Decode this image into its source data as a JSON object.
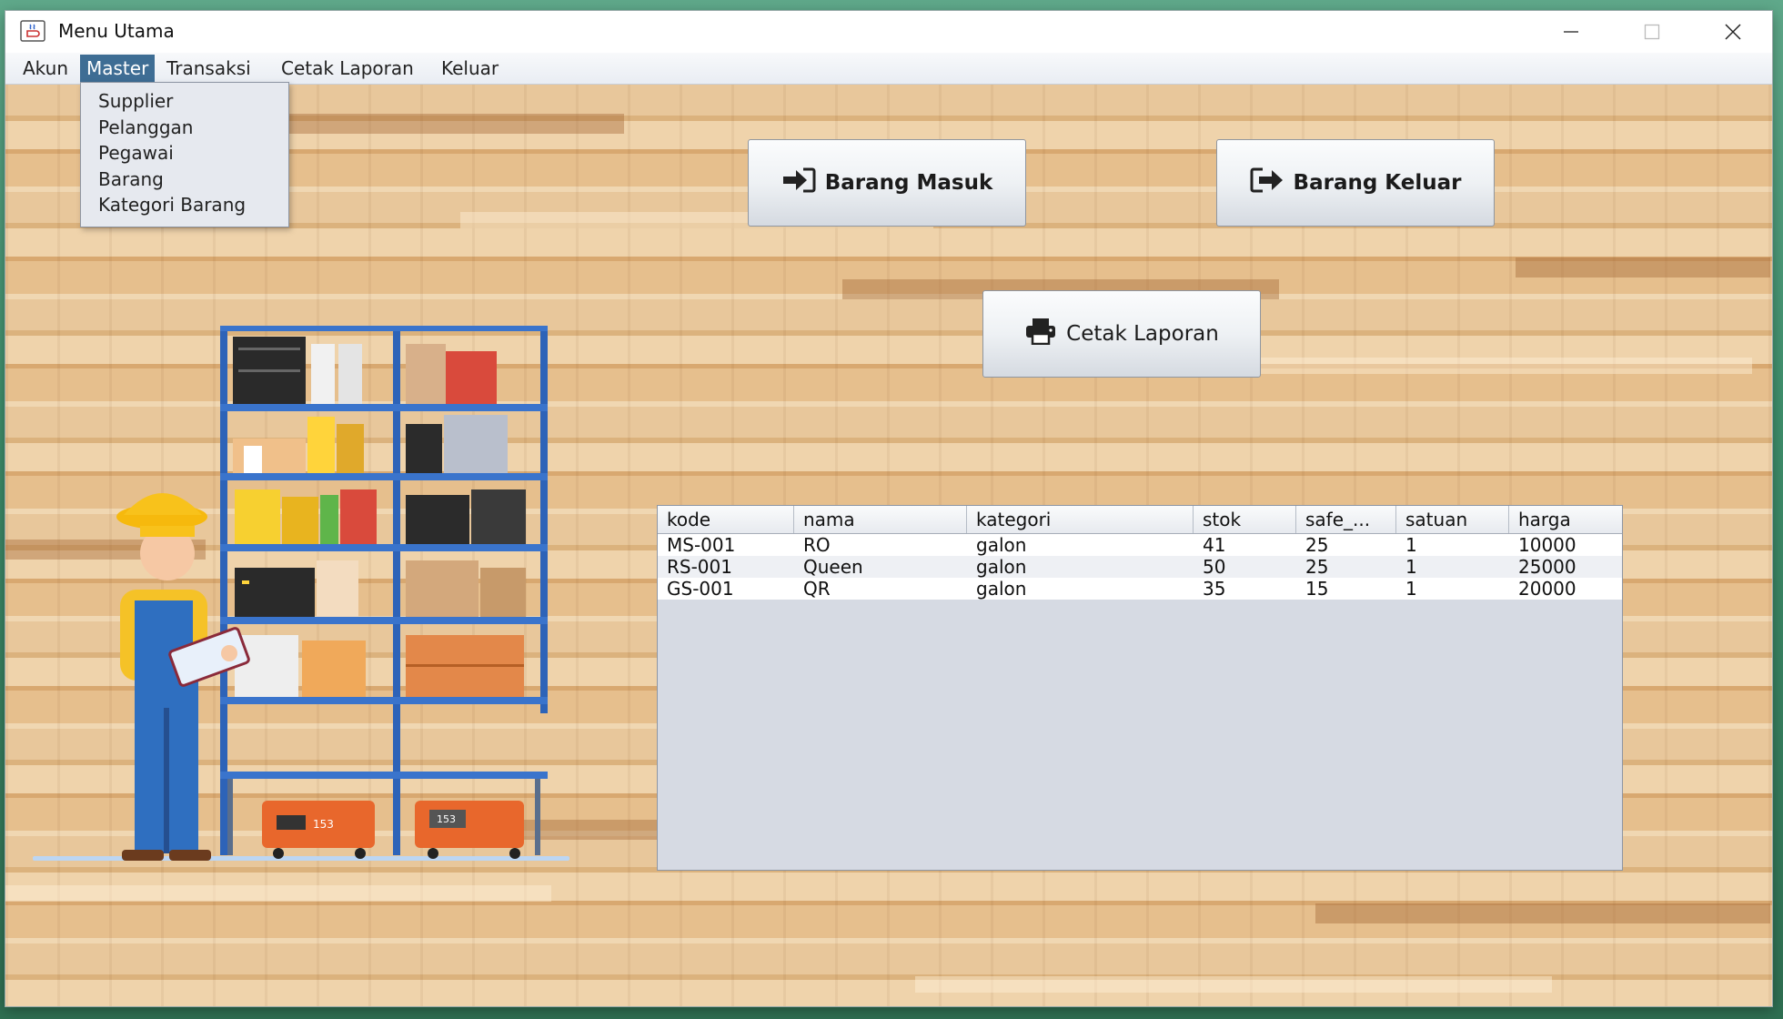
{
  "window": {
    "title": "Menu Utama"
  },
  "menubar": {
    "items": [
      {
        "label": "Akun"
      },
      {
        "label": "Master"
      },
      {
        "label": "Transaksi"
      },
      {
        "label": "Cetak Laporan"
      },
      {
        "label": "Keluar"
      }
    ],
    "active": "Master"
  },
  "master_menu": {
    "items": [
      "Supplier",
      "Pelanggan",
      "Pegawai",
      "Barang",
      "Kategori Barang"
    ]
  },
  "buttons": {
    "barang_masuk": "Barang Masuk",
    "barang_keluar": "Barang Keluar",
    "cetak_laporan": "Cetak Laporan"
  },
  "table": {
    "headers": [
      "kode",
      "nama",
      "kategori",
      "stok",
      "safe_...",
      "satuan",
      "harga"
    ],
    "rows": [
      [
        "MS-001",
        "RO",
        "galon",
        "41",
        "25",
        "1",
        "10000"
      ],
      [
        "RS-001",
        "Queen",
        "galon",
        "50",
        "25",
        "1",
        "25000"
      ],
      [
        "GS-001",
        "QR",
        "galon",
        "35",
        "15",
        "1",
        "20000"
      ]
    ]
  },
  "icons": {
    "app": "java-coffee-icon",
    "barang_masuk": "sign-in-icon",
    "barang_keluar": "sign-out-icon",
    "cetak_laporan": "printer-icon"
  },
  "colors": {
    "menu_active": "#3e6d94",
    "wood": "#e8c79b",
    "table_bg": "#d6dae3"
  },
  "illustration": {
    "shelf_label_1": "153",
    "shelf_label_2": "153"
  }
}
